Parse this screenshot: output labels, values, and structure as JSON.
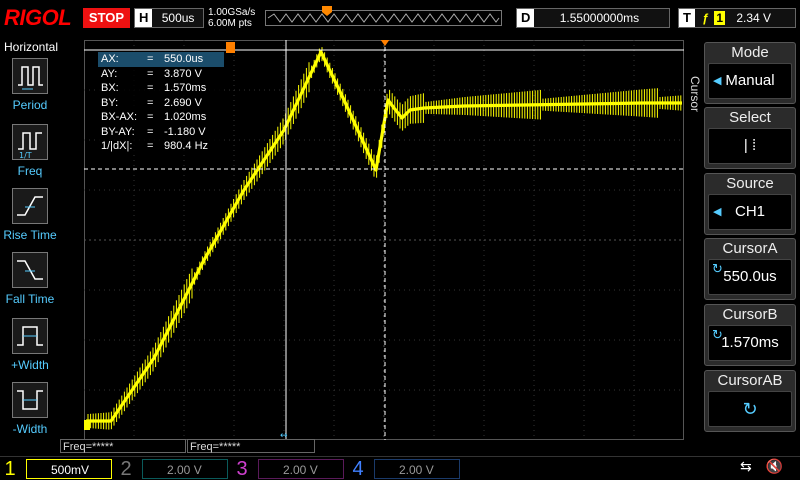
{
  "brand": "RIGOL",
  "run_state": "STOP",
  "horizontal": {
    "key": "H",
    "timebase": "500us",
    "sample_rate": "1.00GSa/s",
    "memory_points": "6.00M pts"
  },
  "delay": {
    "key": "D",
    "value": "1.55000000ms"
  },
  "trigger": {
    "key": "T",
    "edge_icon": "rising-edge-icon",
    "channel": "1",
    "level": "2.34 V"
  },
  "sidebar": {
    "title": "Horizontal",
    "items": [
      {
        "label": "Period",
        "icon": "period-icon"
      },
      {
        "label": "Freq",
        "icon": "freq-icon"
      },
      {
        "label": "Rise Time",
        "icon": "rise-time-icon"
      },
      {
        "label": "Fall Time",
        "icon": "fall-time-icon"
      },
      {
        "label": "+Width",
        "icon": "pos-width-icon"
      },
      {
        "label": "-Width",
        "icon": "neg-width-icon"
      }
    ]
  },
  "cursor_readout": [
    {
      "name": "AX:",
      "eq": "=",
      "value": "550.0us",
      "highlight": true
    },
    {
      "name": "AY:",
      "eq": "=",
      "value": "3.870 V"
    },
    {
      "name": "BX:",
      "eq": "=",
      "value": "1.570ms"
    },
    {
      "name": "BY:",
      "eq": "=",
      "value": "2.690 V"
    },
    {
      "name": "BX-AX:",
      "eq": "=",
      "value": "1.020ms"
    },
    {
      "name": "BY-AY:",
      "eq": "=",
      "value": "-1.180 V"
    },
    {
      "name": "1/|dX|:",
      "eq": "=",
      "value": "980.4 Hz"
    }
  ],
  "menu": {
    "vertical_label": "Cursor",
    "mode": {
      "title": "Mode",
      "value": "Manual"
    },
    "select": {
      "title": "Select",
      "value": "| ⁞"
    },
    "source": {
      "title": "Source",
      "value": "CH1"
    },
    "cursor_a": {
      "title": "CursorA",
      "value": "550.0us"
    },
    "cursor_b": {
      "title": "CursorB",
      "value": "1.570ms"
    },
    "cursor_ab": {
      "title": "CursorAB",
      "value": ""
    }
  },
  "freq_counters": [
    {
      "label": "Freq=*****"
    },
    {
      "label": "Freq=*****"
    }
  ],
  "channels": [
    {
      "num": "1",
      "scale": "500mV",
      "color": "#ffff00",
      "active": true
    },
    {
      "num": "2",
      "scale": "2.00 V",
      "color": "#00e0e0",
      "active": false
    },
    {
      "num": "3",
      "scale": "2.00 V",
      "color": "#e040e0",
      "active": false
    },
    {
      "num": "4",
      "scale": "2.00 V",
      "color": "#4080ff",
      "active": false
    }
  ],
  "colors": {
    "ch1_trace": "#ffff00",
    "cursor_line": "#ffffff",
    "trigger_marker": "#ff8000",
    "accent": "#55ccff",
    "stop": "#ee1111"
  }
}
